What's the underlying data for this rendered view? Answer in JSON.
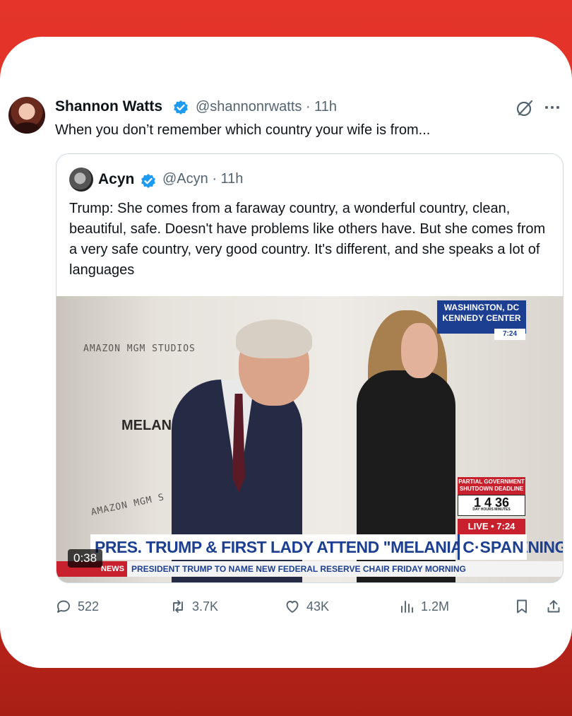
{
  "author": {
    "name": "Shannon Watts",
    "handle_time": "@shannonrwatts · 11h",
    "text": "When you don’t remember which country your wife is from..."
  },
  "quoted": {
    "name": "Acyn",
    "handle_time": "@Acyn · 11h",
    "text": "Trump: She comes from a faraway country, a wonderful country, clean, beautiful, safe. Doesn't have problems like others have. But she comes from a very safe country, very good country. It's different, and she speaks a lot of languages"
  },
  "video": {
    "duration": "0:38",
    "wall_brand_1": "AMAZON MGM STUDIOS",
    "wall_title": "MELANIA",
    "wall_brand_2": "AMAZON MGM S",
    "location": "WASHINGTON, DC",
    "venue": "KENNEDY CENTER",
    "location_time": "7:24",
    "shutdown_label_1": "PARTIAL GOVERNMENT",
    "shutdown_label_2": "SHUTDOWN DEADLINE",
    "countdown": "1  4  36",
    "countdown_units": "DAY   HOURS   MINUTES",
    "live_label": "LIVE • 7:24",
    "headline": "PRES. TRUMP & FIRST LADY ATTEND \"MELANIA\" SCREENING",
    "network": "C·SPAN",
    "news_tag": "NEWS",
    "ticker": "PRESIDENT TRUMP TO NAME NEW FEDERAL RESERVE CHAIR FRIDAY MORNING"
  },
  "actions": {
    "replies": "522",
    "reposts": "3.7K",
    "likes": "43K",
    "views": "1.2M"
  },
  "colors": {
    "background": "#d92d23",
    "verified": "#1d9bf0",
    "cspan_blue": "#1c3f91",
    "cspan_red": "#c8202d"
  },
  "icons": [
    "verified-icon",
    "grok-icon",
    "more-icon",
    "reply-icon",
    "repost-icon",
    "like-icon",
    "views-icon",
    "bookmark-icon",
    "share-icon"
  ]
}
